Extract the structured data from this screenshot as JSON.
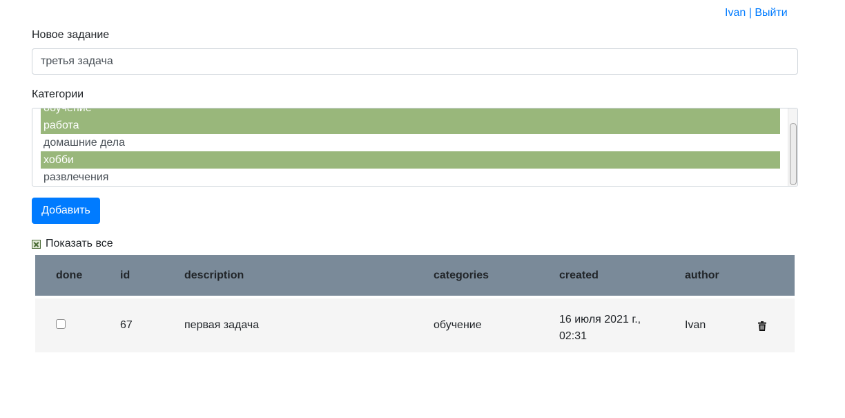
{
  "header": {
    "user_name": "Ivan",
    "separator": "|",
    "logout_label": "Выйти"
  },
  "form": {
    "task_label": "Новое задание",
    "task_value": "третья задача",
    "categories_label": "Категории",
    "categories": [
      {
        "label": "обучение",
        "selected": true
      },
      {
        "label": "работа",
        "selected": true
      },
      {
        "label": "домашние дела",
        "selected": false
      },
      {
        "label": "хобби",
        "selected": true
      },
      {
        "label": "развлечения",
        "selected": false
      }
    ],
    "add_button": "Добавить",
    "show_all_label": "Показать все",
    "show_all_checked": true
  },
  "table": {
    "columns": [
      "done",
      "id",
      "description",
      "categories",
      "created",
      "author"
    ],
    "rows": [
      {
        "done": false,
        "id": "67",
        "description": "первая задача",
        "categories": "обучение",
        "created_date": "16 июля 2021 г.,",
        "created_time": "02:31",
        "author": "Ivan",
        "action_icon": "trash-icon"
      }
    ]
  },
  "colors": {
    "primary": "#007bff",
    "selected_option": "#99b77b",
    "table_header": "#7a8a99",
    "row_background": "#f5f5f5"
  }
}
